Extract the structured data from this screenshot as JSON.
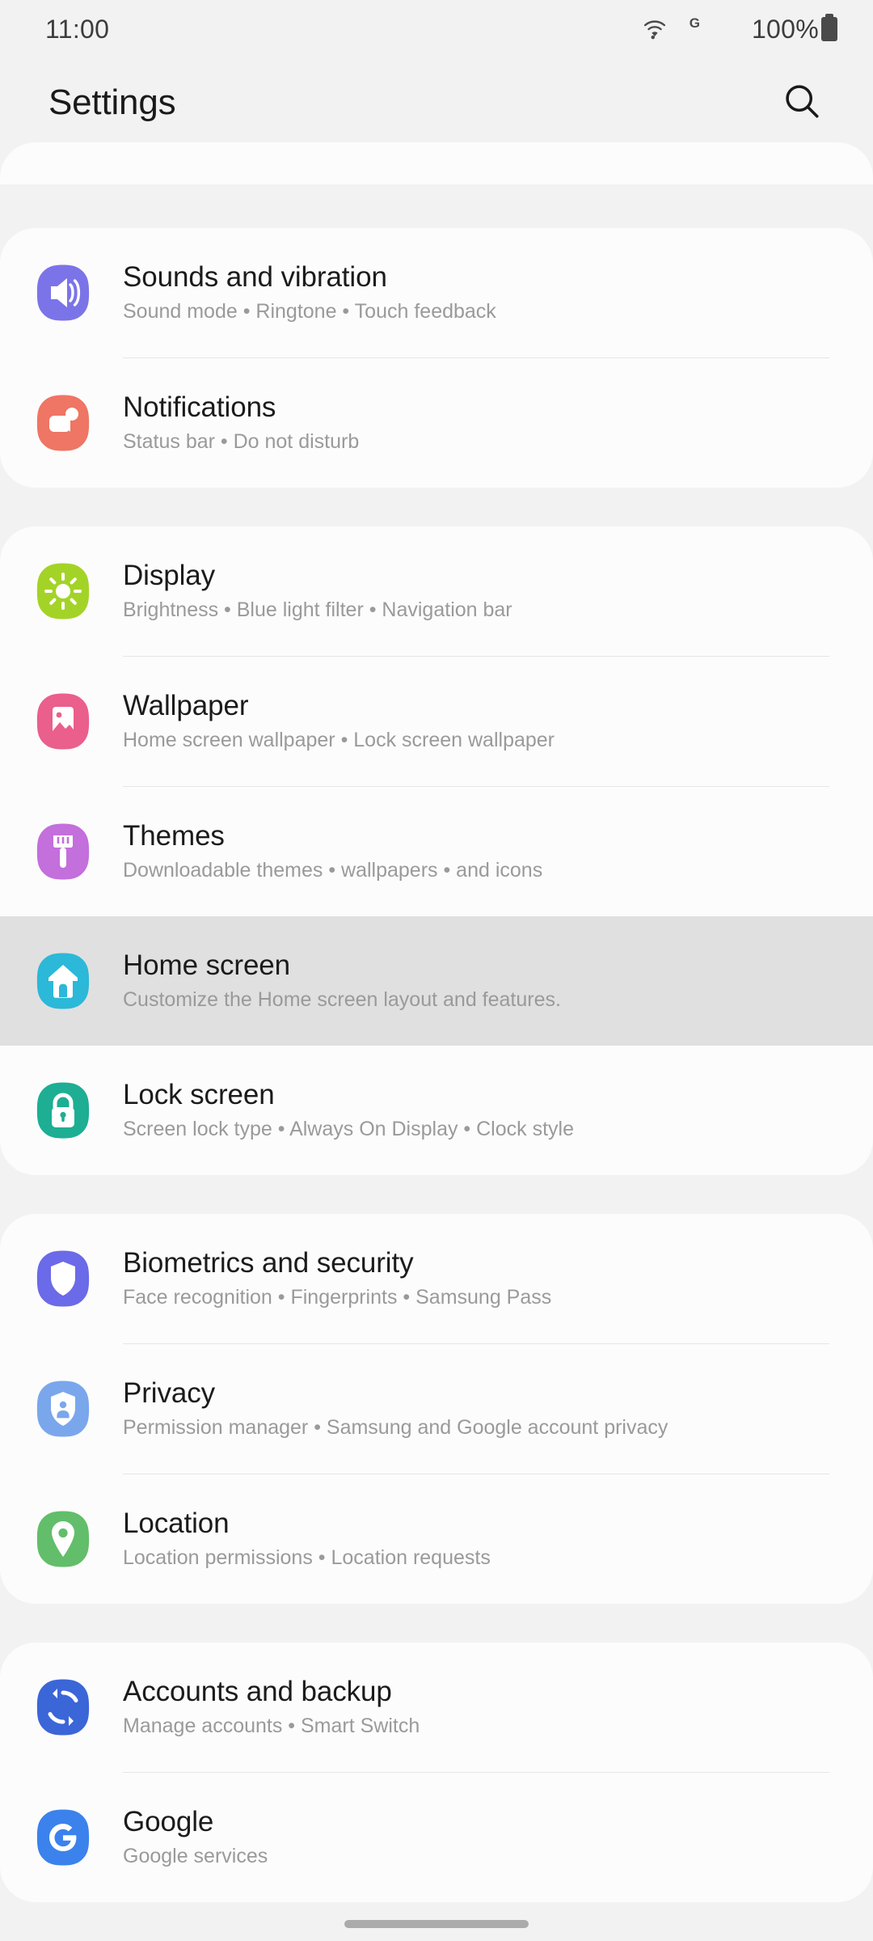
{
  "status_bar": {
    "time": "11:00",
    "wifi_icon": "wifi-icon",
    "network_label": "G",
    "battery_percent": "100%",
    "battery_icon": "battery-full-icon"
  },
  "header": {
    "title": "Settings",
    "search_icon": "search-icon"
  },
  "sections": [
    {
      "id": "partial-top",
      "partial": true,
      "items": []
    },
    {
      "id": "sound-notifications",
      "items": [
        {
          "title": "Sounds and vibration",
          "subtitle": "Sound mode  •  Ringtone  •  Touch feedback",
          "icon": "volume-icon",
          "icon_color": "#7B74E8",
          "pressed": false
        },
        {
          "title": "Notifications",
          "subtitle": "Status bar  •  Do not disturb",
          "icon": "notification-icon",
          "icon_color": "#EF7564",
          "pressed": false
        }
      ]
    },
    {
      "id": "display-personalization",
      "items": [
        {
          "title": "Display",
          "subtitle": "Brightness  •  Blue light filter  •  Navigation bar",
          "icon": "brightness-icon",
          "icon_color": "#A4D327",
          "pressed": false
        },
        {
          "title": "Wallpaper",
          "subtitle": "Home screen wallpaper  •  Lock screen wallpaper",
          "icon": "image-icon",
          "icon_color": "#EA5F8B",
          "pressed": false
        },
        {
          "title": "Themes",
          "subtitle": "Downloadable themes  •  wallpapers  •  and icons",
          "icon": "paintbrush-icon",
          "icon_color": "#C36FDC",
          "pressed": false
        },
        {
          "title": "Home screen",
          "subtitle": "Customize the Home screen layout and features.",
          "icon": "home-icon",
          "icon_color": "#2CB8D8",
          "pressed": true
        },
        {
          "title": "Lock screen",
          "subtitle": "Screen lock type  •  Always On Display  •  Clock style",
          "icon": "lock-icon",
          "icon_color": "#1DAE94",
          "pressed": false
        }
      ]
    },
    {
      "id": "security-privacy",
      "items": [
        {
          "title": "Biometrics and security",
          "subtitle": "Face recognition  •  Fingerprints  •  Samsung Pass",
          "icon": "shield-icon",
          "icon_color": "#6B6AE8",
          "pressed": false
        },
        {
          "title": "Privacy",
          "subtitle": "Permission manager  •  Samsung and Google account privacy",
          "icon": "shield-person-icon",
          "icon_color": "#7AA7EC",
          "pressed": false
        },
        {
          "title": "Location",
          "subtitle": "Location permissions  •  Location requests",
          "icon": "location-pin-icon",
          "icon_color": "#62BE6A",
          "pressed": false
        }
      ]
    },
    {
      "id": "accounts-google",
      "items": [
        {
          "title": "Accounts and backup",
          "subtitle": "Manage accounts  •  Smart Switch",
          "icon": "sync-icon",
          "icon_color": "#3B66D8",
          "pressed": false
        },
        {
          "title": "Google",
          "subtitle": "Google services",
          "icon": "google-g-icon",
          "icon_color": "#3B82EC",
          "pressed": false
        }
      ]
    }
  ],
  "home_indicator": "home-indicator"
}
